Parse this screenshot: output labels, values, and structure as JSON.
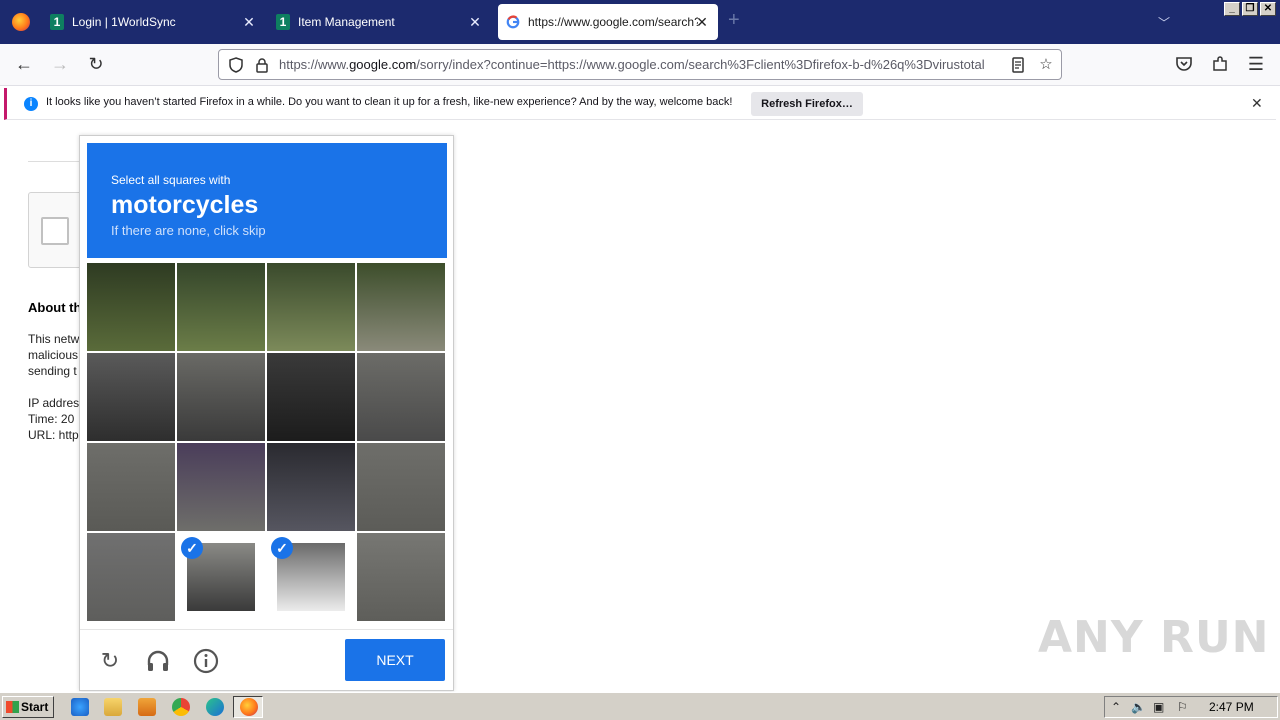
{
  "browser": {
    "tabs": [
      {
        "label": "Login | 1WorldSync",
        "favicon": "1worldsync-icon"
      },
      {
        "label": "Item Management",
        "favicon": "1worldsync-icon"
      },
      {
        "label": "https://www.google.com/search?c",
        "favicon": "google-icon"
      }
    ],
    "new_tab_symbol": "+",
    "url_prefix": "https://www.",
    "url_domain": "google.com",
    "url_rest": "/sorry/index?continue=https://www.google.com/search%3Fclient%3Dfirefox-b-d%26q%3Dvirustotal"
  },
  "notification": {
    "message": "It looks like you haven’t started Firefox in a while. Do you want to clean it up for a fresh, like-new experience? And by the way, welcome back!",
    "button": "Refresh Firefox…"
  },
  "page": {
    "about_heading": "About th",
    "lines": [
      "This netw",
      "malicious",
      "sending t",
      "IP addres",
      "Time: 20",
      "URL: http"
    ]
  },
  "challenge": {
    "instruction": "Select all squares with",
    "target": "motorcycles",
    "hint": "If there are none, click skip",
    "next_label": "NEXT",
    "selected_tiles": [
      13,
      14
    ]
  },
  "watermark": "ANY RUN",
  "taskbar": {
    "start_label": "Start",
    "clock": "2:47 PM"
  }
}
